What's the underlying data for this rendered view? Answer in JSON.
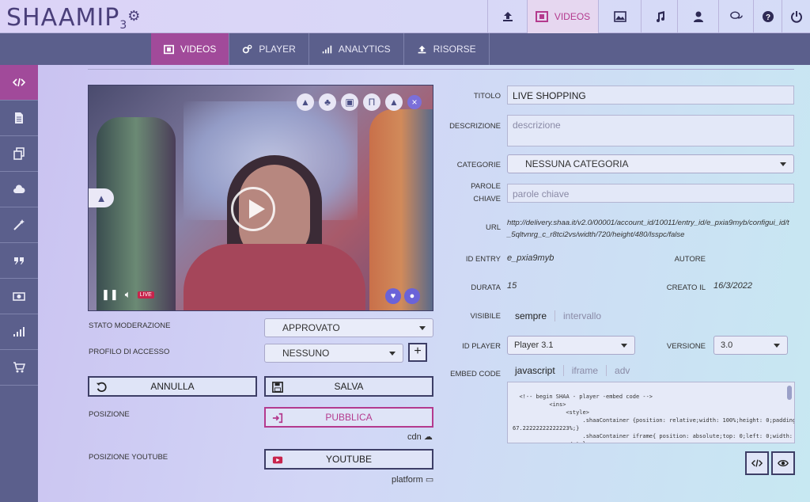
{
  "header": {
    "logo_text": "SHAAMIP",
    "logo_version": "3",
    "nav": [
      {
        "name": "upload-icon",
        "label": ""
      },
      {
        "name": "videos",
        "label": "VIDEOS"
      },
      {
        "name": "image-icon",
        "label": ""
      },
      {
        "name": "music-icon",
        "label": ""
      },
      {
        "name": "user-icon",
        "label": ""
      },
      {
        "name": "chat-icon",
        "label": ""
      },
      {
        "name": "help-icon",
        "label": ""
      },
      {
        "name": "power-icon",
        "label": ""
      }
    ]
  },
  "subnav": {
    "tabs": [
      {
        "label": "VIDEOS",
        "icon": "film-icon"
      },
      {
        "label": "PLAYER",
        "icon": "cogs-icon"
      },
      {
        "label": "ANALYTICS",
        "icon": "bars-icon"
      },
      {
        "label": "RISORSE",
        "icon": "upload-icon"
      }
    ]
  },
  "sidebar": [
    "code-icon",
    "document-icon",
    "copy-icon",
    "cloud-icon",
    "magic-wand-icon",
    "quote-icon",
    "money-icon",
    "signal-icon",
    "cart-icon"
  ],
  "video": {
    "live_label": "LIVE"
  },
  "left_form": {
    "moderation_label": "STATO MODERAZIONE",
    "moderation_value": "APPROVATO",
    "access_label": "PROFILO DI ACCESSO",
    "access_value": "NESSUNO",
    "plus": "+",
    "cancel_label": "ANNULLA",
    "save_label": "SALVA",
    "position_label": "POSIZIONE",
    "publish_label": "PUBBLICA",
    "cdn_label": "cdn",
    "youtube_position_label": "POSIZIONE YOUTUBE",
    "youtube_label": "YOUTUBE",
    "platform_label": "platform"
  },
  "right_form": {
    "title_label": "TITOLO",
    "title_value": "LIVE SHOPPING",
    "desc_label": "DESCRIZIONE",
    "desc_placeholder": "descrizione",
    "category_label": "CATEGORIE",
    "category_value": "NESSUNA CATEGORIA",
    "keywords_label_1": "PAROLE",
    "keywords_label_2": "CHIAVE",
    "keywords_placeholder": "parole chiave",
    "url_label": "URL",
    "url_value_1": "http://delivery.shaa.it/v2.0/00001/account_id/10011/entry_id/e_pxia9myb/configui_id/t",
    "url_value_2": "_5qltvnrg_c_r8tci2vs/width/720/height/480/lsspc/false",
    "entry_label": "ID ENTRY",
    "entry_value": "e_pxia9myb",
    "author_label": "AUTORE",
    "duration_label": "DURATA",
    "duration_value": "15",
    "created_label": "CREATO IL",
    "created_value": "16/3/2022",
    "visible_label": "VISIBILE",
    "visible_always": "sempre",
    "visible_interval": "intervallo",
    "player_label": "ID PLAYER",
    "player_value": "Player 3.1",
    "version_label": "VERSIONE",
    "version_value": "3.0",
    "embed_label": "EMBED CODE",
    "embed_tabs": [
      "javascript",
      "iframe",
      "adv"
    ],
    "embed_code": "<!-- begin SHAA - player -embed code -->\n           <ins>\n                <style>\n                     .shaaContainer {position: relative;width: 100%;height: 0;padding-bottom:\n67.22222222222223%;}\n                     .shaaContainer iframe{ position: absolute;top: 0;left: 0;width: 100%; height: 100%;}\n                </style>\n                <div class=\"shaaContainer\">"
  }
}
